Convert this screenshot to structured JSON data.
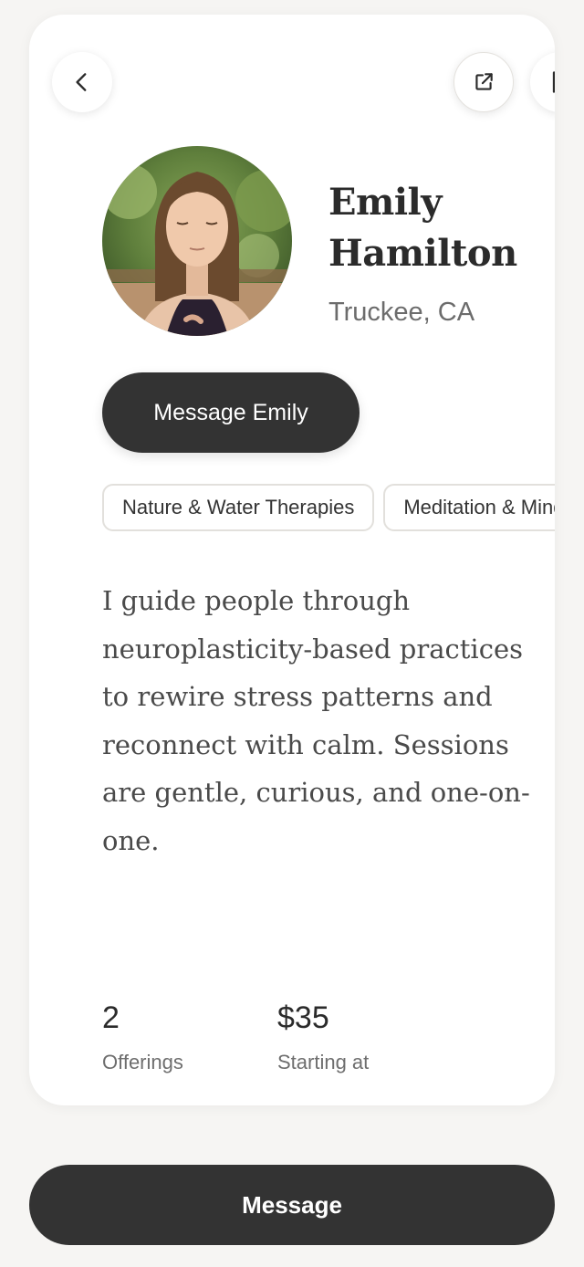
{
  "header": {
    "back_icon": "chevron-left-icon",
    "share_icon": "external-link-icon",
    "bookmark_icon": "bookmark-icon"
  },
  "profile": {
    "first_name": "Emily",
    "last_name": "Hamilton",
    "location": "Truckee, CA",
    "message_button_label": "Message Emily"
  },
  "tags": [
    "Nature & Water Therapies",
    "Meditation & Mindfulness"
  ],
  "bio": "I guide people through neuroplasticity-based practices to rewire stress patterns and reconnect with calm. Sessions are gentle, curious, and one-on-one.",
  "stats": {
    "offerings_value": "2",
    "offerings_label": "Offerings",
    "price_value": "$35",
    "price_label": "Starting at"
  },
  "footer": {
    "message_label": "Message"
  },
  "colors": {
    "background": "#f6f5f3",
    "card": "#ffffff",
    "button_dark": "#333333",
    "text_primary": "#2b2b2b",
    "text_secondary": "#6c6c6c"
  }
}
